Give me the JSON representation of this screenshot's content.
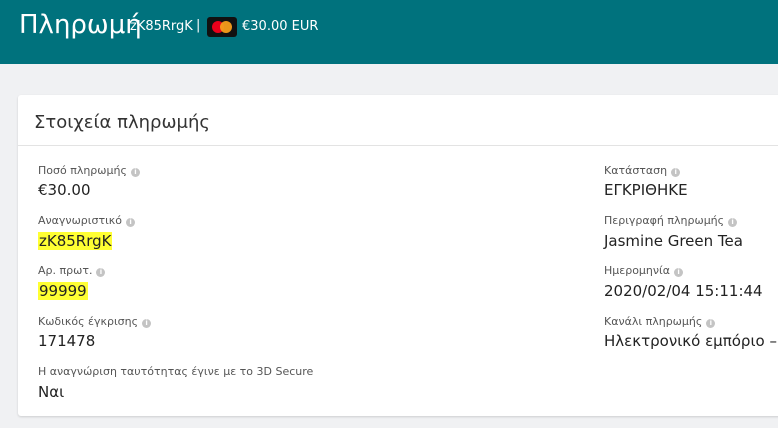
{
  "header": {
    "title": "Πληρωμή",
    "payment_id": "zK85RrgK",
    "separator": "|",
    "card_icon": "mastercard-icon",
    "amount": "€30.00 EUR",
    "background": "#00727d"
  },
  "panel": {
    "title": "Στοιχεία πληρωμής"
  },
  "left_fields": [
    {
      "label": "Ποσό πληρωμής",
      "value": "€30.00"
    },
    {
      "label": "Αναγνωριστικό",
      "value": "zK85RrgK"
    },
    {
      "label": "Αρ. πρωτ.",
      "value": "99999"
    },
    {
      "label": "Κωδικός έγκρισης",
      "value": "171478"
    },
    {
      "label": "Η αναγνώριση ταυτότητας έγινε με το 3D Secure",
      "value": "Ναι"
    }
  ],
  "right_fields": [
    {
      "label": "Κατάσταση",
      "value": "ΕΓΚΡΙΘΗΚΕ"
    },
    {
      "label": "Περιγραφή πληρωμής",
      "value": "Jasmine Green Tea"
    },
    {
      "label": "Ημερομηνία",
      "value": "2020/02/04 15:11:44"
    },
    {
      "label": "Κανάλι πληρωμής",
      "value": "Ηλεκτρονικό εμπόριο –"
    }
  ],
  "info_glyph": "i",
  "highlight_color": "#ffff33"
}
